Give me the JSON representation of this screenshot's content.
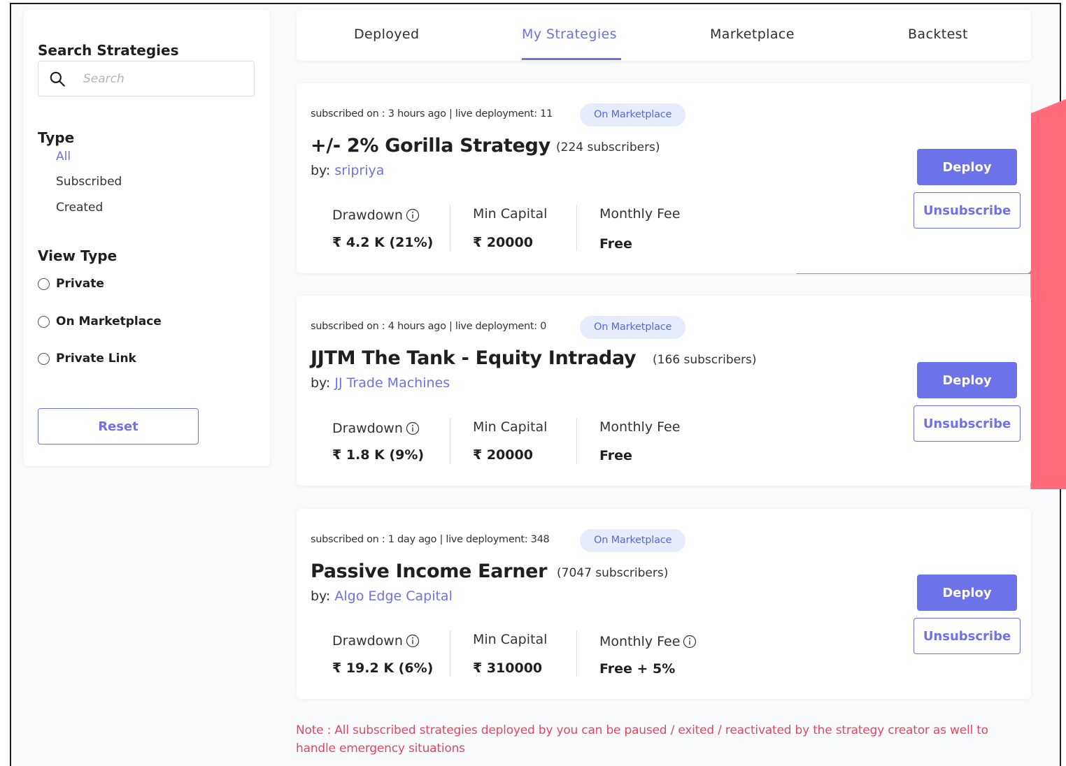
{
  "sidebar": {
    "title": "Search Strategies",
    "search_placeholder": "Search",
    "type_title": "Type",
    "type_items": [
      "All",
      "Subscribed",
      "Created"
    ],
    "type_active": "All",
    "view_type_title": "View Type",
    "view_types": [
      "Private",
      "On Marketplace",
      "Private Link"
    ],
    "reset_label": "Reset"
  },
  "tabs": [
    {
      "label": "Deployed"
    },
    {
      "label": "My Strategies"
    },
    {
      "label": "Marketplace"
    },
    {
      "label": "Backtest"
    }
  ],
  "active_tab": "My Strategies",
  "cards": [
    {
      "meta": "subscribed on : 3 hours ago | live deployment: 11",
      "badge": "On Marketplace",
      "name": "+/- 2% Gorilla Strategy",
      "subscribers": "(224 subscribers)",
      "by_prefix": "by: ",
      "author": "sripriya",
      "drawdown_label": "Drawdown",
      "drawdown_value": "₹ 4.2 K (21%)",
      "min_capital_label": "Min Capital",
      "min_capital_value": "₹ 20000",
      "monthly_fee_label": "Monthly Fee",
      "monthly_fee_value": "Free",
      "deploy_label": "Deploy",
      "unsubscribe_label": "Unsubscribe"
    },
    {
      "meta": "subscribed on : 4 hours ago | live deployment: 0",
      "badge": "On Marketplace",
      "name": "JJTM The Tank - Equity Intraday",
      "subscribers": "(166 subscribers)",
      "by_prefix": "by: ",
      "author": "JJ Trade Machines",
      "drawdown_label": "Drawdown",
      "drawdown_value": "₹ 1.8 K (9%)",
      "min_capital_label": "Min Capital",
      "min_capital_value": "₹ 20000",
      "monthly_fee_label": "Monthly Fee",
      "monthly_fee_value": "Free",
      "deploy_label": "Deploy",
      "unsubscribe_label": "Unsubscribe"
    },
    {
      "meta": "subscribed on : 1 day ago | live deployment: 348",
      "badge": "On Marketplace",
      "name": "Passive Income Earner",
      "subscribers": "(7047 subscribers)",
      "by_prefix": "by: ",
      "author": "Algo Edge Capital",
      "drawdown_label": "Drawdown",
      "drawdown_value": "₹ 19.2 K (6%)",
      "min_capital_label": "Min Capital",
      "min_capital_value": "₹ 310000",
      "monthly_fee_label": "Monthly Fee",
      "monthly_fee_value": "Free + 5%",
      "deploy_label": "Deploy",
      "unsubscribe_label": "Unsubscribe"
    }
  ],
  "note": "Note : All subscribed strategies deployed by you can be paused / exited / reactivated by the strategy creator as well to handle emergency situations",
  "colors": {
    "accent": "#6c72e8",
    "badge_bg": "#e6ecfb",
    "note": "#e64560",
    "decoration": "#ff6b7a"
  }
}
